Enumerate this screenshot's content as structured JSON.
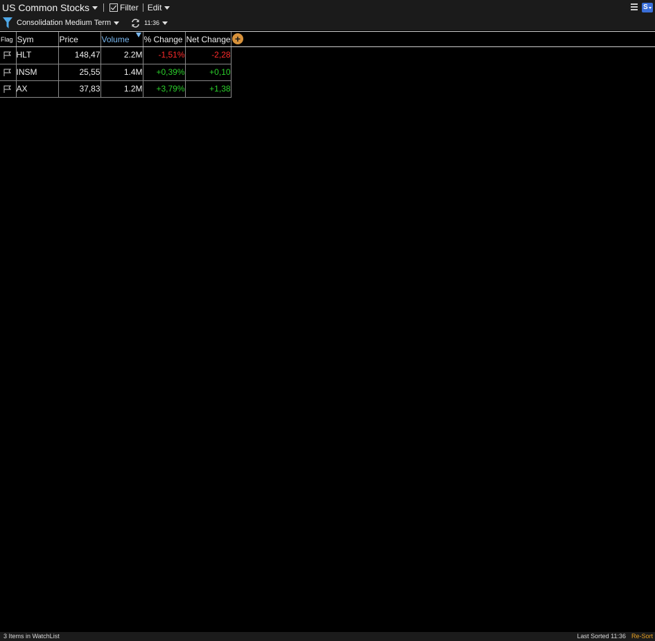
{
  "header": {
    "list_title": "US Common Stocks",
    "filter_label": "Filter",
    "filter_checked": true,
    "edit_label": "Edit",
    "preset": "Consolidation Medium Term",
    "refresh_time": "11:36"
  },
  "colors": {
    "negative": "#ff2b2b",
    "positive": "#2bd12b",
    "sorted_column": "#7ab8f0",
    "accent": "#d7913a",
    "resort": "#e8a020"
  },
  "table": {
    "columns": [
      "Flag",
      "Sym",
      "Price",
      "Volume",
      "% Change",
      "Net Change"
    ],
    "sorted_column": "Volume",
    "rows": [
      {
        "sym": "HLT",
        "price": "148,47",
        "volume": "2.2M",
        "pct_change": "-1,51%",
        "net_change": "-2,28",
        "direction": "down"
      },
      {
        "sym": "INSM",
        "price": "25,55",
        "volume": "1.4M",
        "pct_change": "+0,39%",
        "net_change": "+0,10",
        "direction": "up"
      },
      {
        "sym": "AX",
        "price": "37,83",
        "volume": "1.2M",
        "pct_change": "+3,79%",
        "net_change": "+1,38",
        "direction": "up"
      }
    ]
  },
  "footer": {
    "items_text": "3 Items in WatchList",
    "last_sorted": "Last Sorted 11:36",
    "resort_label": "Re-Sort"
  }
}
